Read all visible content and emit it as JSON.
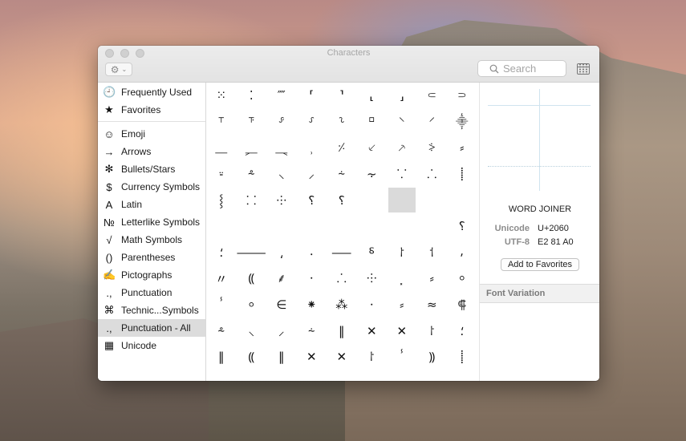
{
  "window": {
    "title": "Characters",
    "gear_icon": "⚙",
    "gear_chevron": "⌄"
  },
  "search": {
    "placeholder": "Search"
  },
  "sidebar": {
    "items": [
      {
        "icon": "clock-icon",
        "glyph": "🕘",
        "label": "Frequently Used"
      },
      {
        "icon": "star-icon",
        "glyph": "★",
        "label": "Favorites"
      },
      {
        "icon": "smiley-icon",
        "glyph": "☺",
        "label": "Emoji"
      },
      {
        "icon": "arrow-icon",
        "glyph": "→",
        "label": "Arrows"
      },
      {
        "icon": "asterisk-icon",
        "glyph": "✻",
        "label": "Bullets/Stars"
      },
      {
        "icon": "dollar-icon",
        "glyph": "$",
        "label": "Currency Symbols"
      },
      {
        "icon": "latin-a-icon",
        "glyph": "A",
        "label": "Latin"
      },
      {
        "icon": "numero-icon",
        "glyph": "№",
        "label": "Letterlike Symbols"
      },
      {
        "icon": "sqrt-icon",
        "glyph": "√",
        "label": "Math Symbols"
      },
      {
        "icon": "parentheses-icon",
        "glyph": "()",
        "label": "Parentheses"
      },
      {
        "icon": "pencil-icon",
        "glyph": "✍",
        "label": "Pictographs"
      },
      {
        "icon": "punctuation-icon",
        "glyph": ".,",
        "label": "Punctuation"
      },
      {
        "icon": "command-icon",
        "glyph": "⌘",
        "label": "Technic...Symbols"
      },
      {
        "icon": "punctuation-icon",
        "glyph": ".,",
        "label": "Punctuation - All"
      },
      {
        "icon": "unicode-table-icon",
        "glyph": "▦",
        "label": "Unicode"
      }
    ],
    "selected_index": 13
  },
  "grid": {
    "rows": [
      [
        "⁙",
        "⁚",
        "⁗",
        "⸢",
        "⸣",
        "⸤",
        "⸥",
        "⸦",
        "⸧"
      ],
      [
        "⸆",
        "⸇",
        "⸈",
        "⸉",
        "⸊",
        "⸋",
        "⸌",
        "⸍",
        "⸎"
      ],
      [
        "⸏",
        "⸐",
        "⸑",
        "⸒",
        "⸓",
        "⸔",
        "⸕",
        "⸖",
        "⸗"
      ],
      [
        "⸚",
        "⸛",
        "⸜",
        "⸝",
        "⸞",
        "⸟",
        "⸪",
        "⸫",
        "⸽"
      ],
      [
        "⸾",
        "⸬",
        "⸭",
        "⸮",
        "⸮",
        "",
        "",
        "",
        ""
      ],
      [
        "",
        "",
        "",
        "",
        "",
        "",
        "",
        "",
        "⸮"
      ],
      [
        "⸵",
        "⸻",
        "⸲",
        "⸳",
        "⸺",
        "⸹",
        "⸷",
        "⸶",
        "⸴"
      ],
      [
        "〃",
        "⸨",
        "⸙",
        "⸱",
        "⸫",
        "⸭",
        "⸼",
        "⸗",
        "⸰"
      ],
      [
        "ⸯ",
        "⸰",
        "∈",
        "⁕",
        "⁂",
        "⸱",
        "⸗",
        "≈",
        "⸿"
      ],
      [
        "⸛",
        "⸜",
        "⸝",
        "⸞",
        "‖",
        "✕",
        "✕",
        "⸷",
        "⸵"
      ],
      [
        "‖",
        "⸨",
        "‖",
        "✕",
        "✕",
        "⸷",
        "ⸯ",
        "⸩",
        "⸽"
      ],
      [
        "⸚",
        "",
        "",
        "",
        "",
        "",
        "",
        "",
        ""
      ]
    ],
    "selected": {
      "row": 4,
      "col": 6
    }
  },
  "detail": {
    "char_name": "WORD JOINER",
    "unicode_label": "Unicode",
    "unicode_value": "U+2060",
    "utf8_label": "UTF-8",
    "utf8_value": "E2 81 A0",
    "add_favorites_label": "Add to Favorites",
    "font_variation_label": "Font Variation"
  }
}
